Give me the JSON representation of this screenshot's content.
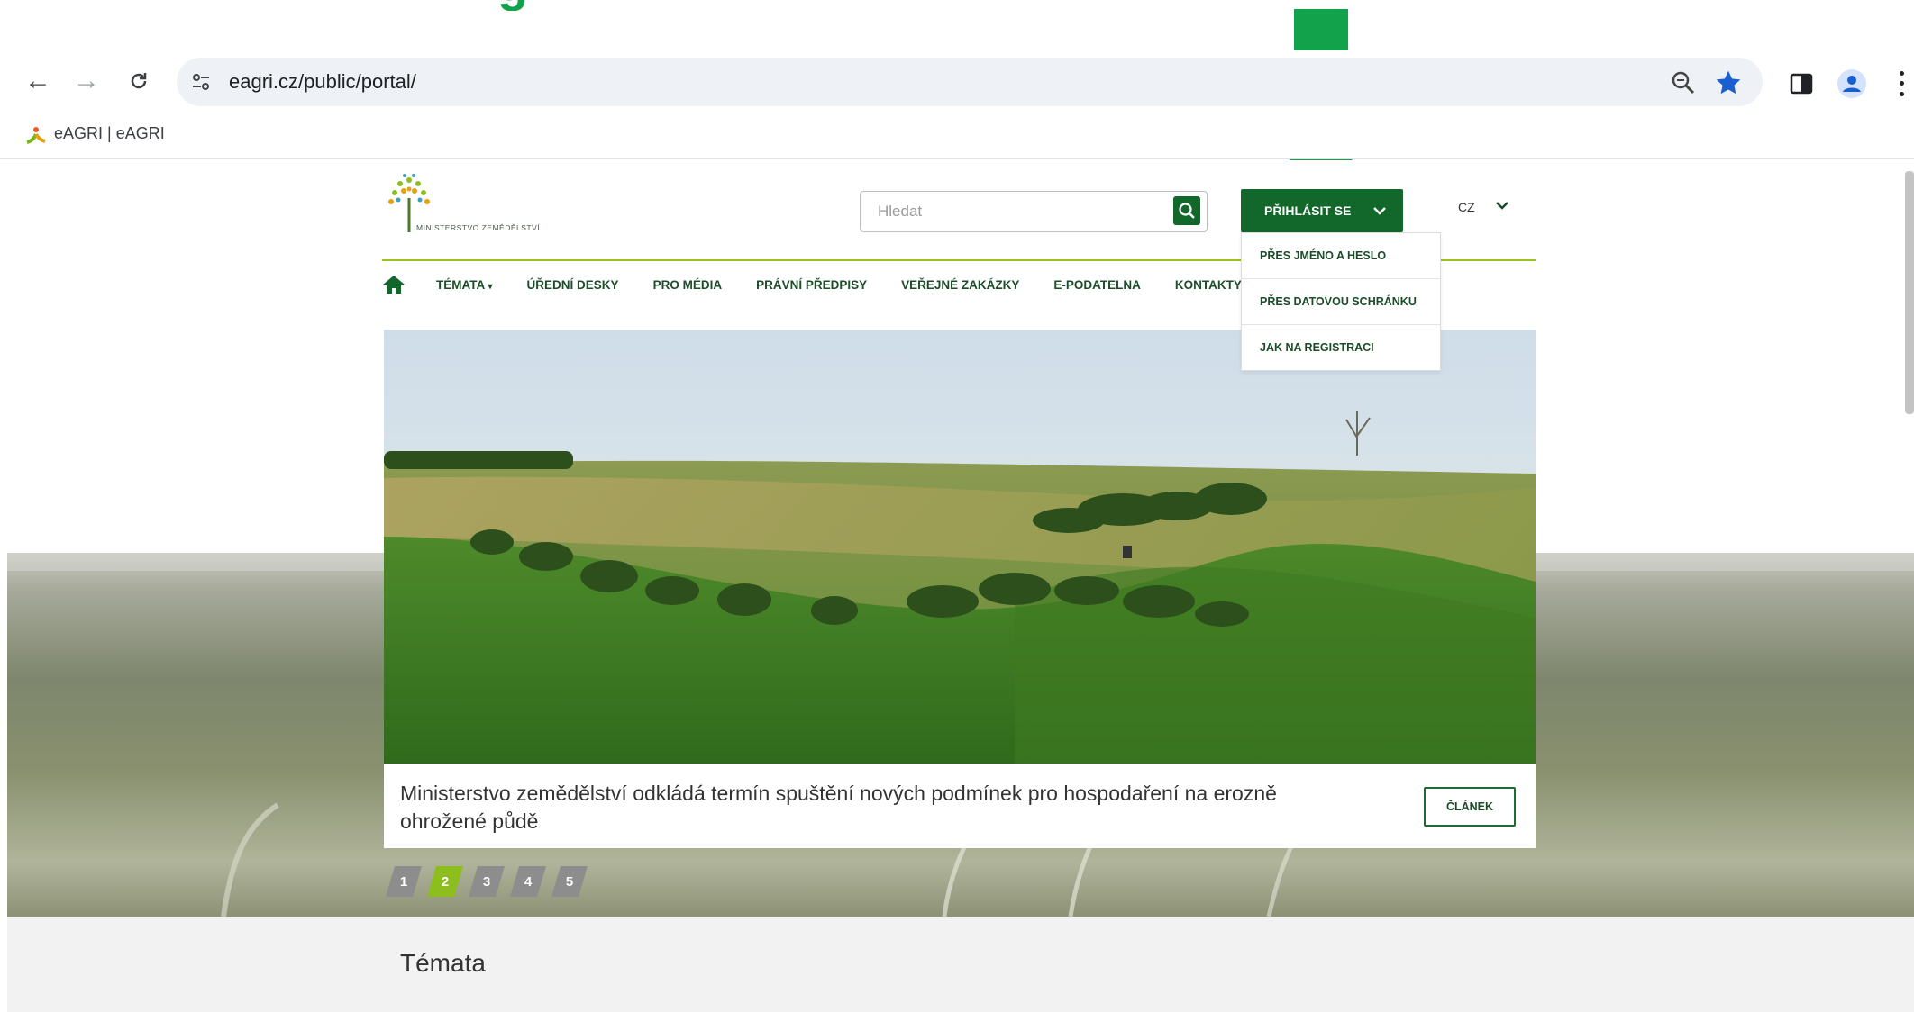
{
  "annotation": {
    "arrow_color": "#12a24b"
  },
  "browser": {
    "url": "eagri.cz/public/portal/",
    "bookmark": "eAGRI | eAGRI"
  },
  "site": {
    "logo_text": "MINISTERSTVO ZEMĚDĚLSTVÍ",
    "search_placeholder": "Hledat",
    "login_label": "PŘIHLÁSIT SE",
    "lang": "CZ",
    "menu": [
      "TÉMATA",
      "ÚŘEDNÍ DESKY",
      "PRO MÉDIA",
      "PRÁVNÍ PŘEDPISY",
      "VEŘEJNÉ ZAKÁZKY",
      "E-PODATELNA",
      "KONTAKTY"
    ],
    "login_menu": [
      "PŘES JMÉNO A HESLO",
      "PŘES DATOVOU SCHRÁNKU",
      "JAK NA REGISTRACI"
    ],
    "caption": "Ministerstvo zemědělství odkládá termín spuštění nových podmínek pro hospodaření na erozně ohrožené půdě",
    "article_button": "ČLÁNEK",
    "slides": [
      "1",
      "2",
      "3",
      "4",
      "5"
    ],
    "active_slide": "2",
    "section_title": "Témata",
    "colors": {
      "primary": "#12672b",
      "accent": "#9ac31c",
      "active_dot": "#8cbf1e"
    }
  }
}
